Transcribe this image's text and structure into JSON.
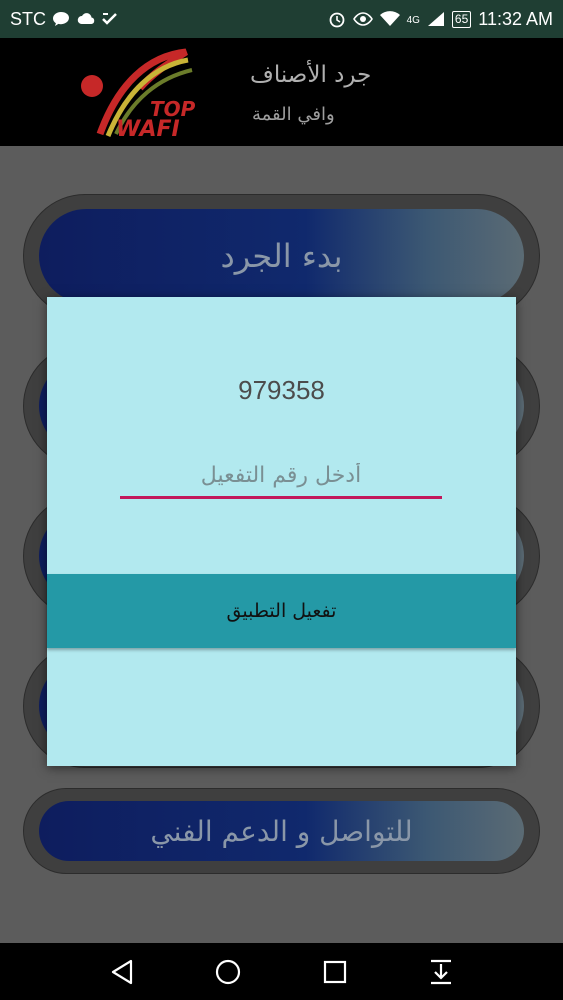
{
  "status_bar": {
    "carrier": "STC",
    "network": "4G",
    "battery": "65",
    "time": "11:32 AM",
    "icons": [
      "message-icon",
      "cloud-icon",
      "check-icon",
      "alarm-icon",
      "eye-icon",
      "wifi-icon",
      "signal-icon",
      "battery-icon"
    ]
  },
  "app": {
    "logo_text_top": "TOP",
    "logo_text_bottom": "WAFI",
    "title": "جرد الأصناف",
    "subtitle": "وافي القمة"
  },
  "menu": {
    "items": [
      {
        "label": "بدء الجرد"
      },
      {
        "label": ""
      },
      {
        "label": ""
      },
      {
        "label": ""
      },
      {
        "label": "للتواصل و الدعم الفني"
      }
    ]
  },
  "dialog": {
    "code": "979358",
    "input_value": "",
    "input_placeholder": "أدخل رقم التفعيل",
    "activate_label": "تفعيل التطبيق"
  },
  "navigation": {
    "items": [
      "back-icon",
      "home-icon",
      "recents-icon",
      "notifications-down-icon"
    ]
  },
  "colors": {
    "status_bar_bg": "#1f3e33",
    "dialog_bg": "#b2e9ef",
    "accent_button": "#2499a6",
    "input_underline": "#c2185b"
  }
}
